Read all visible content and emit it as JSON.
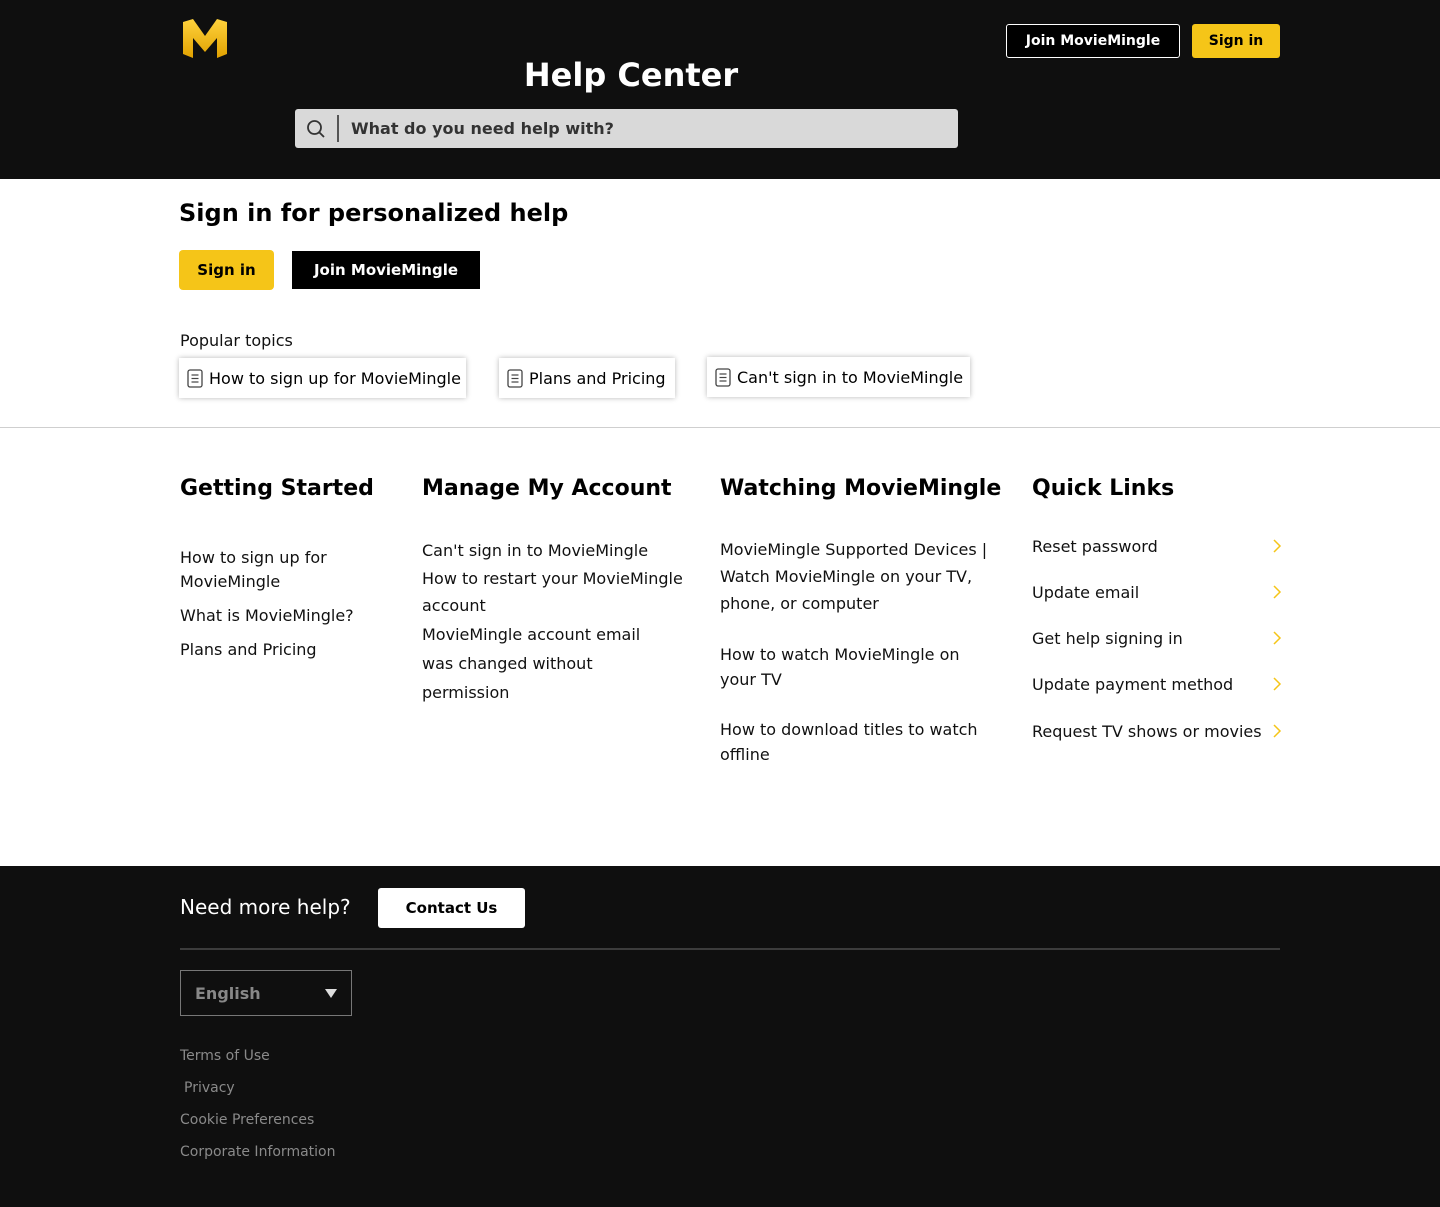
{
  "header": {
    "join_label": "Join MovieMingle",
    "signin_label": "Sign in",
    "title": "Help Center",
    "search_placeholder": "What do you need help with?"
  },
  "colors": {
    "accent": "#f5c518",
    "dark": "#0f0f0f"
  },
  "personal": {
    "title": "Sign in for personalized help",
    "signin_label": "Sign in",
    "join_label": "Join MovieMingle"
  },
  "popular": {
    "label": "Popular topics",
    "topics": [
      "How to sign up for MovieMingle",
      "Plans and Pricing",
      "Can't sign in to MovieMingle"
    ]
  },
  "columns": [
    {
      "title": "Getting Started",
      "links": [
        "How to sign up for MovieMingle",
        "What is MovieMingle?",
        "Plans and Pricing"
      ]
    },
    {
      "title": "Manage My Account",
      "links": [
        "Can't sign in to MovieMingle",
        "How to restart your MovieMingle account",
        "MovieMingle account email was changed without permission"
      ]
    },
    {
      "title": "Watching MovieMingle",
      "links": [
        "MovieMingle Supported Devices | Watch MovieMingle on your TV, phone, or computer",
        "How to watch MovieMingle on your TV",
        "How to download titles to watch offline"
      ]
    },
    {
      "title": "Quick Links",
      "links": [
        "Reset password",
        "Update email",
        "Get help signing in",
        "Update payment method",
        "Request TV shows or movies"
      ]
    }
  ],
  "footer": {
    "need_help": "Need more help?",
    "contact_label": "Contact Us",
    "language": "English",
    "links": [
      "Terms of Use",
      "Privacy",
      "Cookie Preferences",
      "Corporate Information"
    ]
  }
}
